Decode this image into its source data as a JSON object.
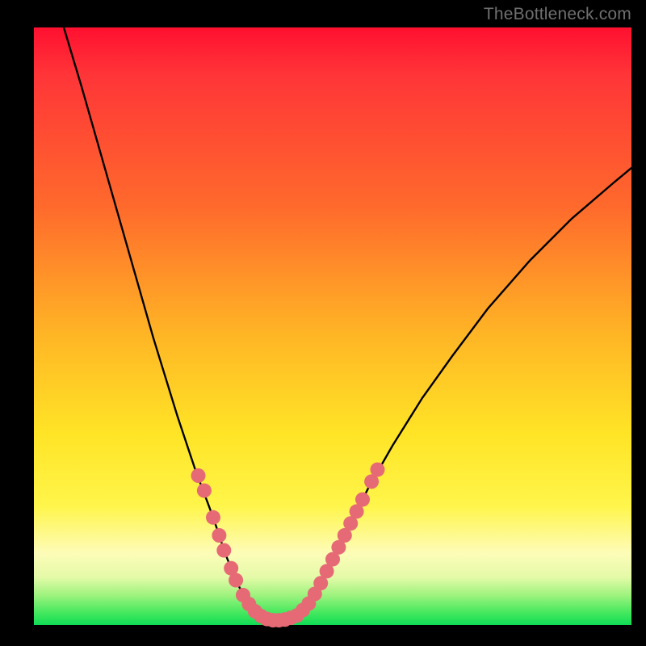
{
  "watermark": "TheBottleneck.com",
  "colors": {
    "curve_stroke": "#000000",
    "marker_fill": "#e66a75",
    "marker_stroke": "#d54f5e"
  },
  "chart_data": {
    "type": "line",
    "title": "",
    "xlabel": "",
    "ylabel": "",
    "xlim": [
      0,
      100
    ],
    "ylim": [
      0,
      100
    ],
    "curve": [
      {
        "x": 5.0,
        "y": 100.0
      },
      {
        "x": 8.0,
        "y": 90.0
      },
      {
        "x": 12.0,
        "y": 76.0
      },
      {
        "x": 16.0,
        "y": 62.0
      },
      {
        "x": 20.0,
        "y": 48.0
      },
      {
        "x": 24.0,
        "y": 35.0
      },
      {
        "x": 27.0,
        "y": 26.0
      },
      {
        "x": 30.0,
        "y": 18.0
      },
      {
        "x": 32.0,
        "y": 12.0
      },
      {
        "x": 34.0,
        "y": 7.0
      },
      {
        "x": 36.0,
        "y": 3.5
      },
      {
        "x": 38.0,
        "y": 1.5
      },
      {
        "x": 40.0,
        "y": 0.8
      },
      {
        "x": 42.0,
        "y": 0.8
      },
      {
        "x": 44.0,
        "y": 1.5
      },
      {
        "x": 46.0,
        "y": 3.5
      },
      {
        "x": 48.0,
        "y": 7.0
      },
      {
        "x": 50.0,
        "y": 11.0
      },
      {
        "x": 53.0,
        "y": 17.0
      },
      {
        "x": 56.0,
        "y": 23.0
      },
      {
        "x": 60.0,
        "y": 30.0
      },
      {
        "x": 65.0,
        "y": 38.0
      },
      {
        "x": 70.0,
        "y": 45.0
      },
      {
        "x": 76.0,
        "y": 53.0
      },
      {
        "x": 83.0,
        "y": 61.0
      },
      {
        "x": 90.0,
        "y": 68.0
      },
      {
        "x": 97.0,
        "y": 74.0
      },
      {
        "x": 100.0,
        "y": 76.5
      }
    ],
    "markers": [
      {
        "x": 27.5,
        "y": 25.0
      },
      {
        "x": 28.5,
        "y": 22.5
      },
      {
        "x": 30.0,
        "y": 18.0
      },
      {
        "x": 31.0,
        "y": 15.0
      },
      {
        "x": 31.8,
        "y": 12.5
      },
      {
        "x": 33.0,
        "y": 9.5
      },
      {
        "x": 33.8,
        "y": 7.5
      },
      {
        "x": 35.0,
        "y": 5.0
      },
      {
        "x": 36.0,
        "y": 3.5
      },
      {
        "x": 37.0,
        "y": 2.3
      },
      {
        "x": 38.0,
        "y": 1.5
      },
      {
        "x": 39.0,
        "y": 1.0
      },
      {
        "x": 40.0,
        "y": 0.8
      },
      {
        "x": 41.0,
        "y": 0.8
      },
      {
        "x": 42.0,
        "y": 0.9
      },
      {
        "x": 43.0,
        "y": 1.2
      },
      {
        "x": 44.0,
        "y": 1.6
      },
      {
        "x": 45.0,
        "y": 2.5
      },
      {
        "x": 46.0,
        "y": 3.6
      },
      {
        "x": 47.0,
        "y": 5.2
      },
      {
        "x": 48.0,
        "y": 7.0
      },
      {
        "x": 49.0,
        "y": 9.0
      },
      {
        "x": 50.0,
        "y": 11.0
      },
      {
        "x": 51.0,
        "y": 13.0
      },
      {
        "x": 52.0,
        "y": 15.0
      },
      {
        "x": 53.0,
        "y": 17.0
      },
      {
        "x": 54.0,
        "y": 19.0
      },
      {
        "x": 55.0,
        "y": 21.0
      },
      {
        "x": 56.5,
        "y": 24.0
      },
      {
        "x": 57.5,
        "y": 26.0
      }
    ]
  }
}
